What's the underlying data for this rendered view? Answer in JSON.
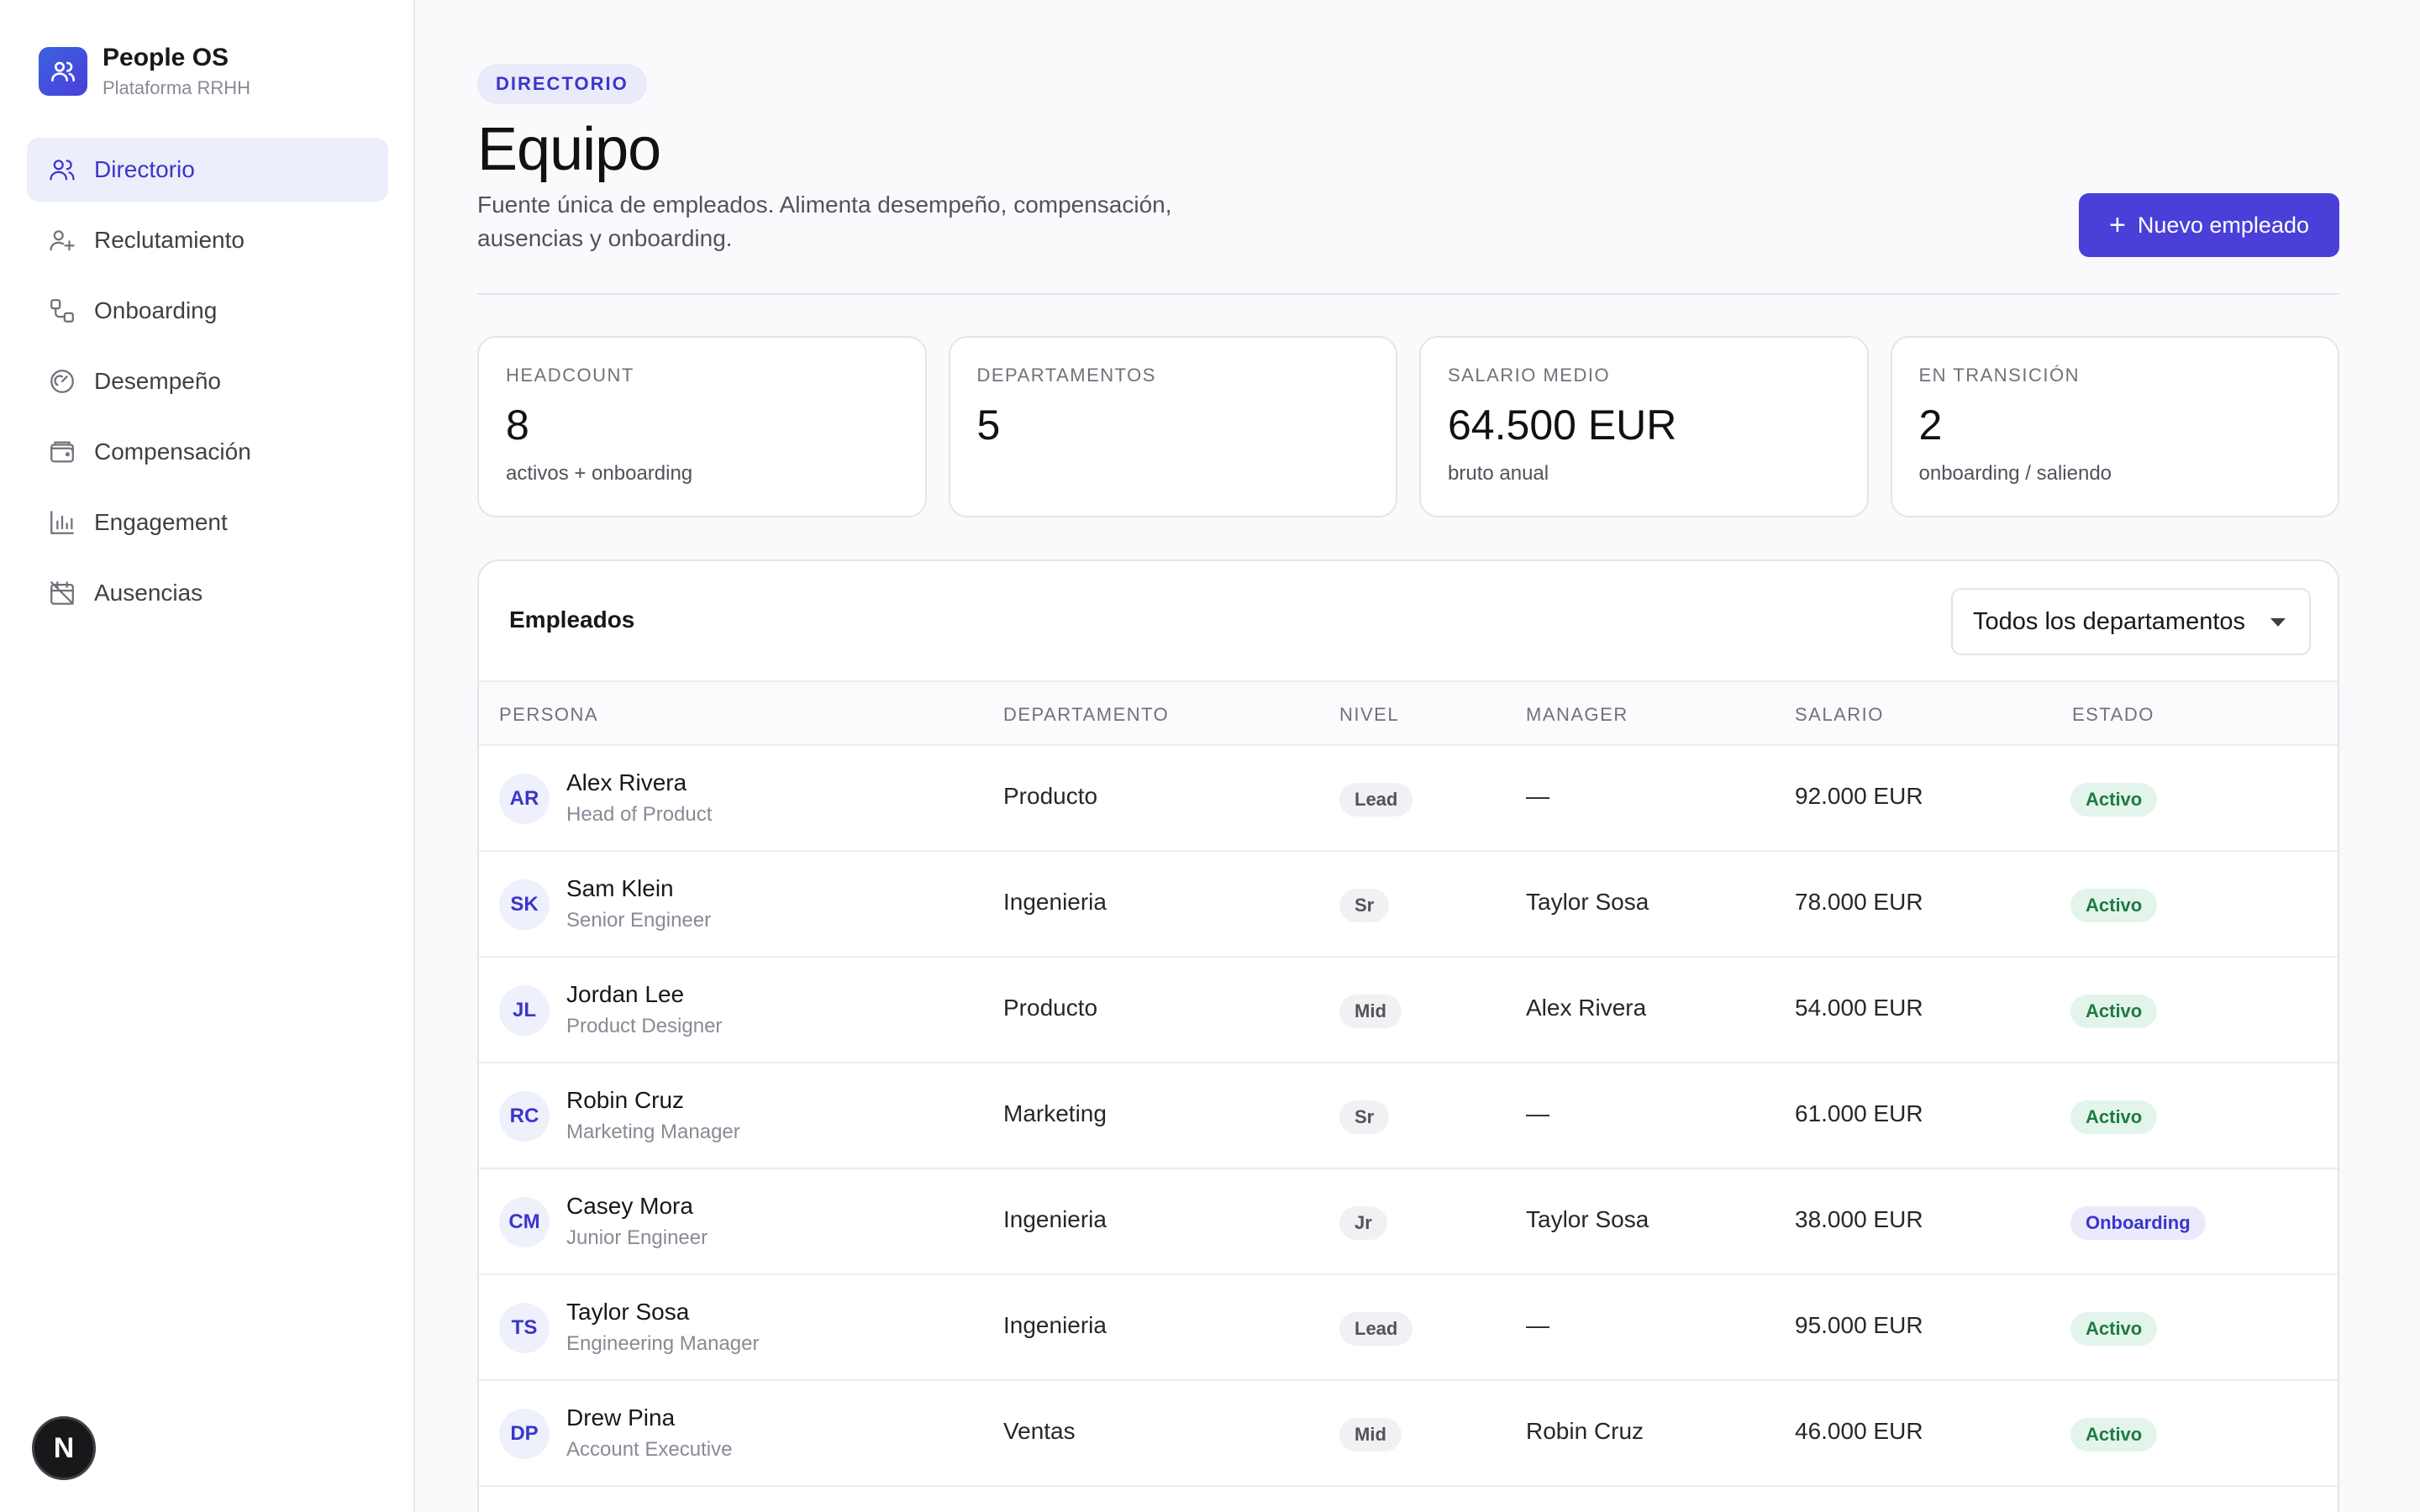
{
  "app": {
    "name": "People OS",
    "subtitle": "Plataforma RRHH",
    "badge": "N"
  },
  "sidebar": {
    "items": [
      {
        "label": "Directorio",
        "icon": "users-icon",
        "active": true
      },
      {
        "label": "Reclutamiento",
        "icon": "user-plus-icon",
        "active": false
      },
      {
        "label": "Onboarding",
        "icon": "route-icon",
        "active": false
      },
      {
        "label": "Desempeño",
        "icon": "gauge-icon",
        "active": false
      },
      {
        "label": "Compensación",
        "icon": "wallet-icon",
        "active": false
      },
      {
        "label": "Engagement",
        "icon": "bar-chart-icon",
        "active": false
      },
      {
        "label": "Ausencias",
        "icon": "calendar-off-icon",
        "active": false
      }
    ]
  },
  "header": {
    "eyebrow": "DIRECTORIO",
    "title": "Equipo",
    "description": "Fuente única de empleados. Alimenta desempeño, compensación, ausencias y onboarding.",
    "primary_action": "Nuevo empleado"
  },
  "stats": [
    {
      "label": "HEADCOUNT",
      "value": "8",
      "sub": "activos + onboarding"
    },
    {
      "label": "DEPARTAMENTOS",
      "value": "5",
      "sub": ""
    },
    {
      "label": "SALARIO MEDIO",
      "value": "64.500 EUR",
      "sub": "bruto anual"
    },
    {
      "label": "EN TRANSICIÓN",
      "value": "2",
      "sub": "onboarding / saliendo"
    }
  ],
  "table": {
    "title": "Empleados",
    "filter": {
      "selected": "Todos los departamentos"
    },
    "columns": [
      "PERSONA",
      "DEPARTAMENTO",
      "NIVEL",
      "MANAGER",
      "SALARIO",
      "ESTADO"
    ],
    "rows": [
      {
        "initials": "AR",
        "name": "Alex Rivera",
        "role": "Head of Product",
        "department": "Producto",
        "level": "Lead",
        "manager": "—",
        "salary": "92.000 EUR",
        "status": "Activo"
      },
      {
        "initials": "SK",
        "name": "Sam Klein",
        "role": "Senior Engineer",
        "department": "Ingenieria",
        "level": "Sr",
        "manager": "Taylor Sosa",
        "salary": "78.000 EUR",
        "status": "Activo"
      },
      {
        "initials": "JL",
        "name": "Jordan Lee",
        "role": "Product Designer",
        "department": "Producto",
        "level": "Mid",
        "manager": "Alex Rivera",
        "salary": "54.000 EUR",
        "status": "Activo"
      },
      {
        "initials": "RC",
        "name": "Robin Cruz",
        "role": "Marketing Manager",
        "department": "Marketing",
        "level": "Sr",
        "manager": "—",
        "salary": "61.000 EUR",
        "status": "Activo"
      },
      {
        "initials": "CM",
        "name": "Casey Mora",
        "role": "Junior Engineer",
        "department": "Ingenieria",
        "level": "Jr",
        "manager": "Taylor Sosa",
        "salary": "38.000 EUR",
        "status": "Onboarding"
      },
      {
        "initials": "TS",
        "name": "Taylor Sosa",
        "role": "Engineering Manager",
        "department": "Ingenieria",
        "level": "Lead",
        "manager": "—",
        "salary": "95.000 EUR",
        "status": "Activo"
      },
      {
        "initials": "DP",
        "name": "Drew Pina",
        "role": "Account Executive",
        "department": "Ventas",
        "level": "Mid",
        "manager": "Robin Cruz",
        "salary": "46.000 EUR",
        "status": "Activo"
      }
    ]
  },
  "colors": {
    "accent": "#4a3fd8",
    "active_nav_bg": "#eceefc",
    "status_activo": "#1f7a45",
    "status_onboarding": "#3b36c9"
  }
}
